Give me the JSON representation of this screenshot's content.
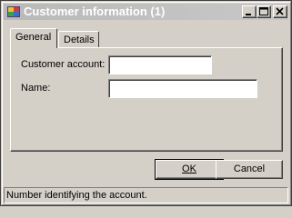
{
  "window": {
    "title": "Customer information (1)"
  },
  "tabs": [
    {
      "label": "General",
      "selected": true
    },
    {
      "label": "Details",
      "selected": false
    }
  ],
  "form": {
    "account_label": "Customer account:",
    "account_value": "",
    "name_label": "Name:",
    "name_value": ""
  },
  "buttons": {
    "ok_label": "OK",
    "cancel_label": "Cancel"
  },
  "status": {
    "text": "Number identifying the account."
  },
  "icons": {
    "app": "app-icon",
    "minimize": "minimize-icon",
    "maximize": "maximize-icon",
    "close": "close-icon"
  },
  "colors": {
    "face": "#d4d0c8",
    "titlebar": "#c0c0c0",
    "title_text": "#ffffff"
  }
}
